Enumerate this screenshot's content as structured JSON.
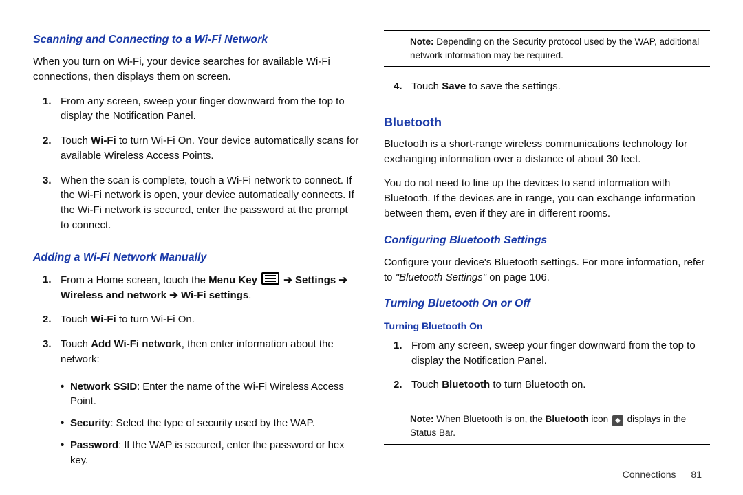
{
  "left": {
    "h_scan": "Scanning and Connecting to a Wi-Fi Network",
    "scan_p": "When you turn on Wi-Fi, your device searches for available Wi-Fi connections, then displays them on screen.",
    "scan_steps": [
      "From any screen, sweep your finger downward from the top to display the Notification Panel.",
      "Touch <b>Wi-Fi</b> to turn Wi-Fi On. Your device automatically scans for available Wireless Access Points.",
      "When the scan is complete, touch a Wi-Fi network to connect. If the Wi-Fi network is open, your device automatically connects. If the Wi-Fi network is secured, enter the password at the prompt to connect."
    ],
    "h_add": "Adding a Wi-Fi Network Manually",
    "add_step1_pre": "From a Home screen, touch the ",
    "add_step1_menukey": "Menu Key",
    "add_step1_settings": "Settings",
    "add_step1_wireless": "Wireless and network",
    "add_step1_wifiset": "Wi-Fi settings",
    "add_step2": "Touch <b>Wi-Fi</b> to turn Wi-Fi On.",
    "add_step3": "Touch <b>Add Wi-Fi network</b>, then enter information about the network:",
    "bullets": {
      "ssid_label": "Network SSID",
      "ssid_text": ": Enter the name of the Wi-Fi Wireless Access Point.",
      "sec_label": "Security",
      "sec_text": ": Select the type of security used by the WAP.",
      "pwd_label": "Password",
      "pwd_text": ": If the WAP is secured, enter the password or hex key."
    }
  },
  "right": {
    "note1_label": "Note:",
    "note1_text": "Depending on the Security protocol used by the WAP, additional network information may be required.",
    "step4": "Touch <b>Save</b> to save the settings.",
    "h_bt": "Bluetooth",
    "bt_p1": "Bluetooth is a short-range wireless communications technology for exchanging information over a distance of about 30 feet.",
    "bt_p2": "You do not need to line up the devices to send information with Bluetooth. If the devices are in range, you can exchange information between them, even if they are in different rooms.",
    "h_conf": "Configuring Bluetooth Settings",
    "conf_p_pre": "Configure your device's Bluetooth settings. For more information, refer to ",
    "conf_ref": "\"Bluetooth Settings\"",
    "conf_p_post": " on page 106.",
    "h_turn": "Turning Bluetooth On or Off",
    "h_turn_on": "Turning Bluetooth On",
    "turn_steps": [
      "From any screen, sweep your finger downward from the top to display the Notification Panel.",
      "Touch <b>Bluetooth</b> to turn Bluetooth on."
    ],
    "note2_label": "Note:",
    "note2_pre": "When Bluetooth is on, the ",
    "note2_bold": "Bluetooth",
    "note2_mid": " icon ",
    "note2_post": " displays in the Status Bar.",
    "bt_glyph": "⁕"
  },
  "footer": {
    "section": "Connections",
    "page": "81"
  }
}
